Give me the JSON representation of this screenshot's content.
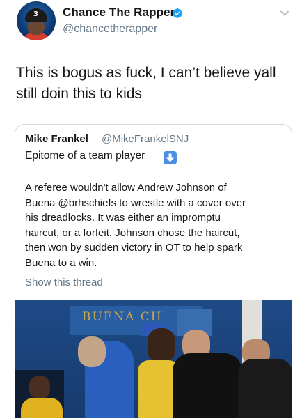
{
  "tweet": {
    "display_name": "Chance The Rapper",
    "handle": "@chancetherapper",
    "text": "This is bogus as fuck, I can’t believe yall\nstill doin this to kids",
    "icons": {
      "verified": "verified-badge-icon",
      "menu": "chevron-down-icon"
    },
    "colors": {
      "verified": "#1da1f2",
      "secondary_text": "#657786"
    }
  },
  "quoted": {
    "display_name": "Mike Frankel",
    "handle": "@MikeFrankelSNJ",
    "line1": "Epitome of a team player",
    "emoji": "down-arrow-emoji-icon",
    "body": "A referee wouldn't allow Andrew Johnson of\nBuena @brhschiefs to wrestle with a cover over\nhis dreadlocks. It was either an impromptu\nhaircut, or a forfeit. Johnson chose the haircut,\nthen won by sudden victory in OT to help spark\nBuena to a win.",
    "show_thread": "Show this thread",
    "photo_sign": "BUENA CH"
  }
}
